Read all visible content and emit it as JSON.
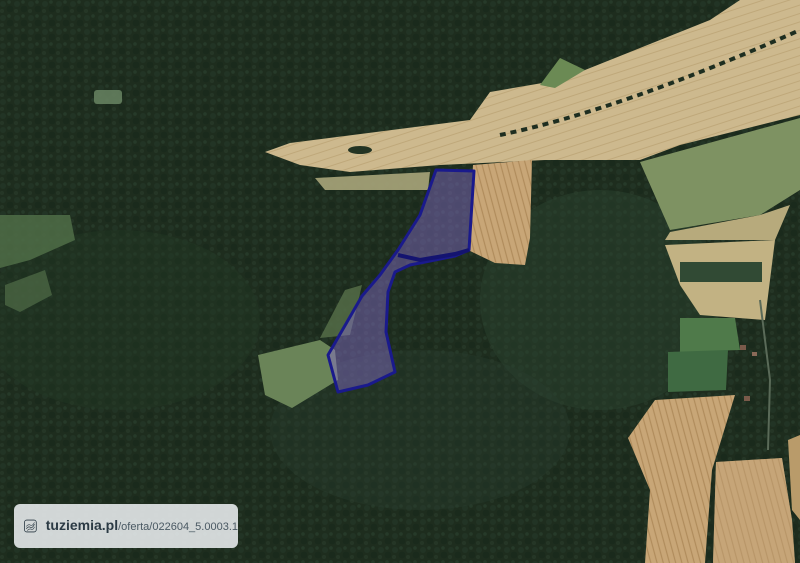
{
  "map": {
    "type": "satellite",
    "parcel": {
      "outline_color": "#1a1a8c",
      "fill_color": "#8a6fd0"
    }
  },
  "watermark": {
    "domain": "tuziemia.pl",
    "path": "/oferta/022604_5.0003.1",
    "icon": "terrain-logo-icon"
  }
}
